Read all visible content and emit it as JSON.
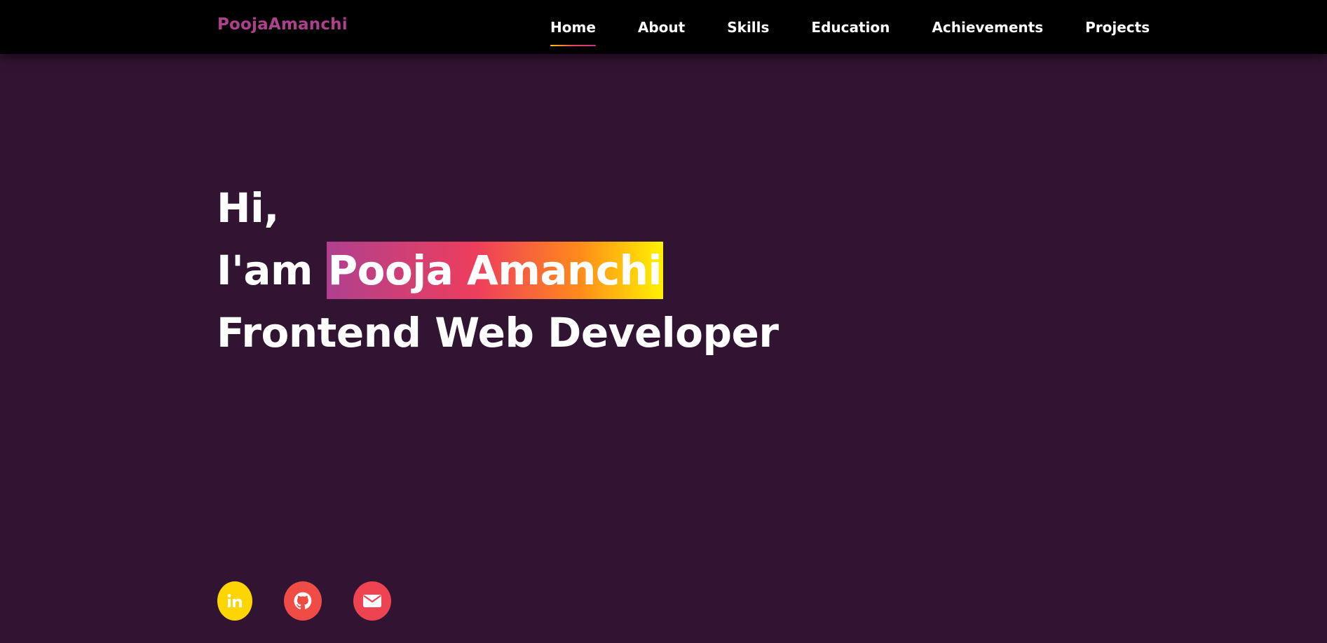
{
  "nav": {
    "logo": "PoojaAmanchi",
    "links": [
      {
        "label": "Home",
        "active": true
      },
      {
        "label": "About"
      },
      {
        "label": "Skills"
      },
      {
        "label": "Education"
      },
      {
        "label": "Achievements"
      },
      {
        "label": "Projects"
      }
    ]
  },
  "hero": {
    "greeting": "Hi,",
    "intro_prefix": "I'am ",
    "name": "Pooja Amanchi",
    "role": "Frontend Web Developer"
  },
  "socials": [
    {
      "name": "linkedin",
      "icon": "linkedin-icon",
      "color": "#ffd500"
    },
    {
      "name": "github",
      "icon": "github-icon",
      "color": "#ee4c45"
    },
    {
      "name": "email",
      "icon": "envelope-icon",
      "color": "#ee4350"
    }
  ],
  "colors": {
    "background": "#311432",
    "navbar": "#000000",
    "logo": "#b03f8f",
    "text": "#ffffff",
    "name_gradient": [
      "#b0408e",
      "#ee3e5c",
      "#ff8a1b",
      "#fff200"
    ]
  }
}
